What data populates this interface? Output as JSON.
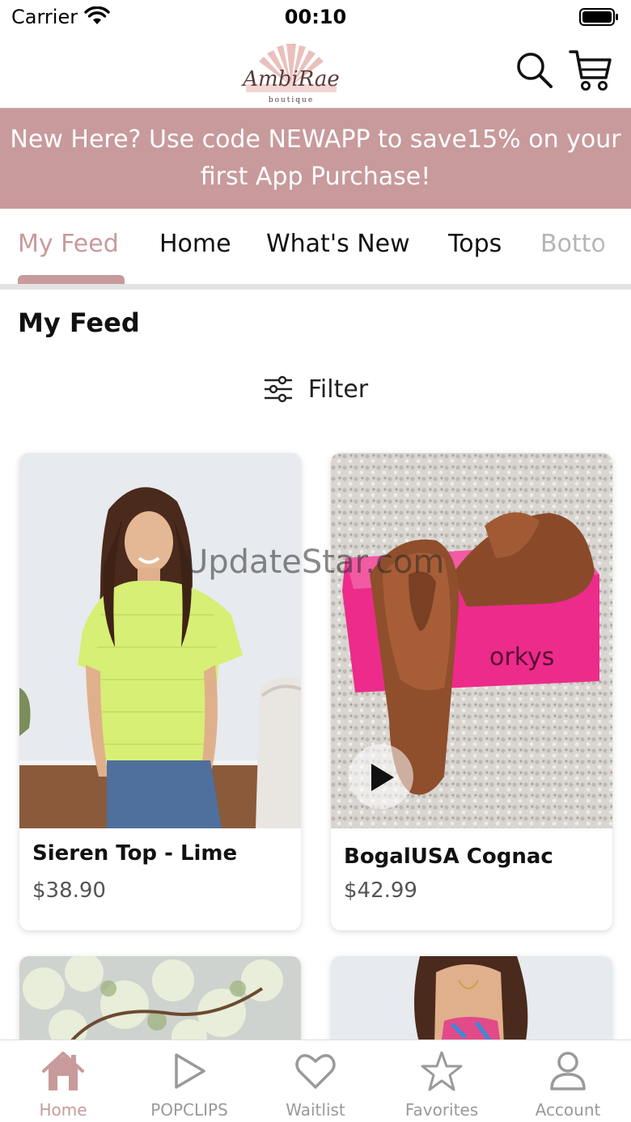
{
  "status_bar": {
    "carrier": "Carrier",
    "time": "00:10"
  },
  "header": {
    "logo_text": "AmbiRae",
    "logo_subtext": "boutique"
  },
  "promo": {
    "text": "New Here? Use code NEWAPP to save15% on your first App Purchase!"
  },
  "tabs": [
    {
      "label": "My Feed",
      "active": true
    },
    {
      "label": "Home"
    },
    {
      "label": "What's New"
    },
    {
      "label": "Tops"
    },
    {
      "label": "Botto"
    }
  ],
  "section": {
    "title": "My Feed",
    "filter_label": "Filter"
  },
  "products": [
    {
      "name": "Sieren Top - Lime",
      "price": "$38.90"
    },
    {
      "name": "BogalUSA Cognac",
      "price": "$42.99",
      "box_text": "orkys"
    }
  ],
  "watermark": "UpdateStar.com",
  "bottom_nav": [
    {
      "label": "Home",
      "icon": "home-icon",
      "active": true
    },
    {
      "label": "POPCLIPS",
      "icon": "play-icon"
    },
    {
      "label": "Waitlist",
      "icon": "heart-icon"
    },
    {
      "label": "Favorites",
      "icon": "star-icon"
    },
    {
      "label": "Account",
      "icon": "person-icon"
    }
  ],
  "colors": {
    "accent": "#c89a9c",
    "inactive": "#9a9a9a"
  }
}
